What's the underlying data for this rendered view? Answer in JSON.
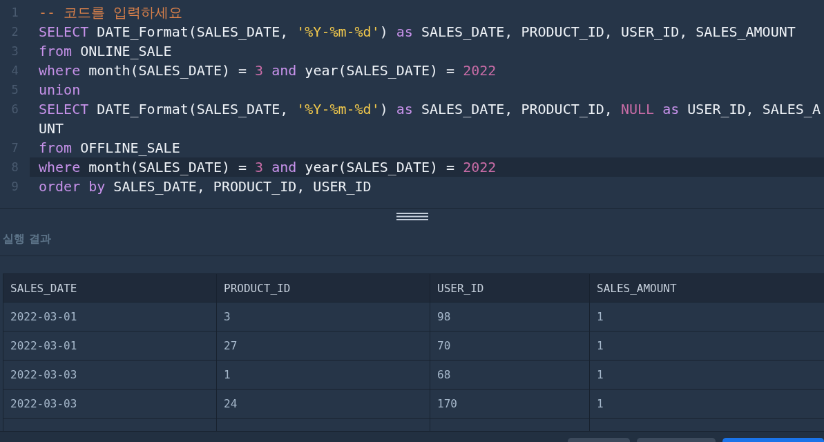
{
  "editor": {
    "lines": [
      {
        "number": "1",
        "active": false,
        "tokens": [
          {
            "kind": "comment",
            "text": "-- 코드를 입력하세요"
          }
        ]
      },
      {
        "number": "2",
        "active": false,
        "tokens": [
          {
            "kind": "keyword",
            "text": "SELECT"
          },
          {
            "kind": "plain",
            "text": " DATE_Format(SALES_DATE, "
          },
          {
            "kind": "string",
            "text": "'%Y-%m-%d'"
          },
          {
            "kind": "plain",
            "text": ") "
          },
          {
            "kind": "keyword",
            "text": "as"
          },
          {
            "kind": "plain",
            "text": " SALES_DATE, PRODUCT_ID, USER_ID, SALES_AMOUNT"
          }
        ]
      },
      {
        "number": "3",
        "active": false,
        "tokens": [
          {
            "kind": "keyword",
            "text": "from"
          },
          {
            "kind": "plain",
            "text": " ONLINE_SALE"
          }
        ]
      },
      {
        "number": "4",
        "active": false,
        "tokens": [
          {
            "kind": "keyword",
            "text": "where"
          },
          {
            "kind": "plain",
            "text": " month(SALES_DATE) = "
          },
          {
            "kind": "number",
            "text": "3"
          },
          {
            "kind": "keyword",
            "text": " and"
          },
          {
            "kind": "plain",
            "text": " year(SALES_DATE) = "
          },
          {
            "kind": "number",
            "text": "2022"
          }
        ]
      },
      {
        "number": "5",
        "active": false,
        "tokens": [
          {
            "kind": "keyword",
            "text": "union"
          }
        ]
      },
      {
        "number": "6",
        "active": false,
        "tokens": [
          {
            "kind": "keyword",
            "text": "SELECT"
          },
          {
            "kind": "plain",
            "text": " DATE_Format(SALES_DATE, "
          },
          {
            "kind": "string",
            "text": "'%Y-%m-%d'"
          },
          {
            "kind": "plain",
            "text": ") "
          },
          {
            "kind": "keyword",
            "text": "as"
          },
          {
            "kind": "plain",
            "text": " SALES_DATE, PRODUCT_ID, "
          },
          {
            "kind": "number",
            "text": "NULL"
          },
          {
            "kind": "keyword",
            "text": " as"
          },
          {
            "kind": "plain",
            "text": " USER_ID, SALES_A"
          }
        ],
        "wrapped": "UNT"
      },
      {
        "number": "7",
        "active": false,
        "tokens": [
          {
            "kind": "keyword",
            "text": "from"
          },
          {
            "kind": "plain",
            "text": " OFFLINE_SALE"
          }
        ]
      },
      {
        "number": "8",
        "active": true,
        "tokens": [
          {
            "kind": "keyword",
            "text": "where"
          },
          {
            "kind": "plain",
            "text": " month(SALES_DATE) = "
          },
          {
            "kind": "number",
            "text": "3"
          },
          {
            "kind": "keyword",
            "text": " and"
          },
          {
            "kind": "plain",
            "text": " year(SALES_DATE) = "
          },
          {
            "kind": "number",
            "text": "2022"
          }
        ]
      },
      {
        "number": "9",
        "active": false,
        "tokens": [
          {
            "kind": "keyword",
            "text": "order by"
          },
          {
            "kind": "plain",
            "text": " SALES_DATE, PRODUCT_ID, USER_ID"
          }
        ]
      }
    ]
  },
  "result": {
    "title": "실행 결과",
    "table": {
      "columns": [
        "SALES_DATE",
        "PRODUCT_ID",
        "USER_ID",
        "SALES_AMOUNT"
      ],
      "rows": [
        [
          "2022-03-01",
          "3",
          "98",
          "1"
        ],
        [
          "2022-03-01",
          "27",
          "70",
          "1"
        ],
        [
          "2022-03-03",
          "1",
          "68",
          "1"
        ],
        [
          "2022-03-03",
          "24",
          "170",
          "1"
        ]
      ]
    }
  }
}
